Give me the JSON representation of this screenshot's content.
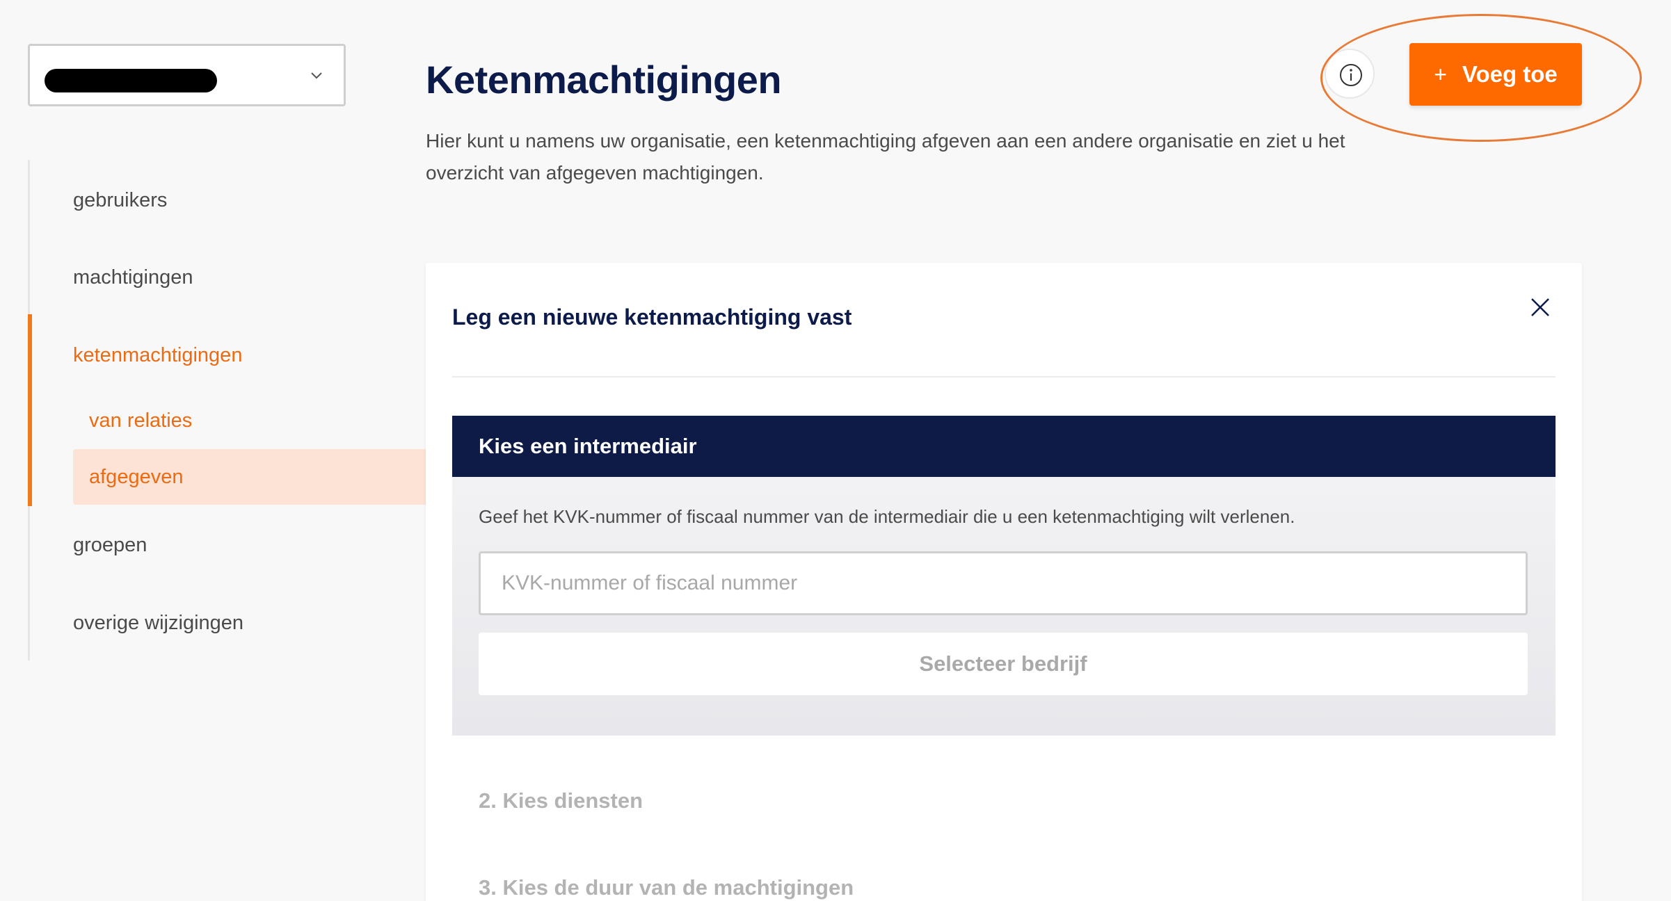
{
  "sidebar": {
    "org_select": {
      "value_redacted": true
    },
    "items": [
      {
        "label": "gebruikers"
      },
      {
        "label": "machtigingen"
      },
      {
        "label": "ketenmachtigingen"
      },
      {
        "label": "groepen"
      },
      {
        "label": "overige wijzigingen"
      }
    ],
    "subitems": [
      {
        "label": "van relaties"
      },
      {
        "label": "afgegeven",
        "selected": true
      }
    ]
  },
  "header": {
    "title": "Ketenmachtigingen",
    "description": "Hier kunt u namens uw organisatie, een ketenmachtiging afgeven aan een andere organisatie en ziet u het overzicht van afgegeven machtigingen.",
    "add_button": {
      "icon": "+",
      "label": "Voeg toe"
    },
    "info_icon": "info-icon"
  },
  "card": {
    "title": "Leg een nieuwe ketenmachtiging vast",
    "close_icon": "close-icon",
    "step1": {
      "header": "Kies een intermediair",
      "help": "Geef het KVK-nummer of fiscaal nummer van de intermediair die u een ketenmachtiging wilt verlenen.",
      "input_placeholder": "KVK-nummer of fiscaal nummer",
      "input_value": "",
      "button_label": "Selecteer bedrijf"
    },
    "step2": {
      "label": "2. Kies diensten"
    },
    "step3": {
      "label": "3. Kies de duur van de machtigingen"
    }
  },
  "colors": {
    "accent": "#ff6a00",
    "navy": "#0d1b46",
    "selected_bg": "#fce3d6",
    "annotation": "#e87a35"
  }
}
